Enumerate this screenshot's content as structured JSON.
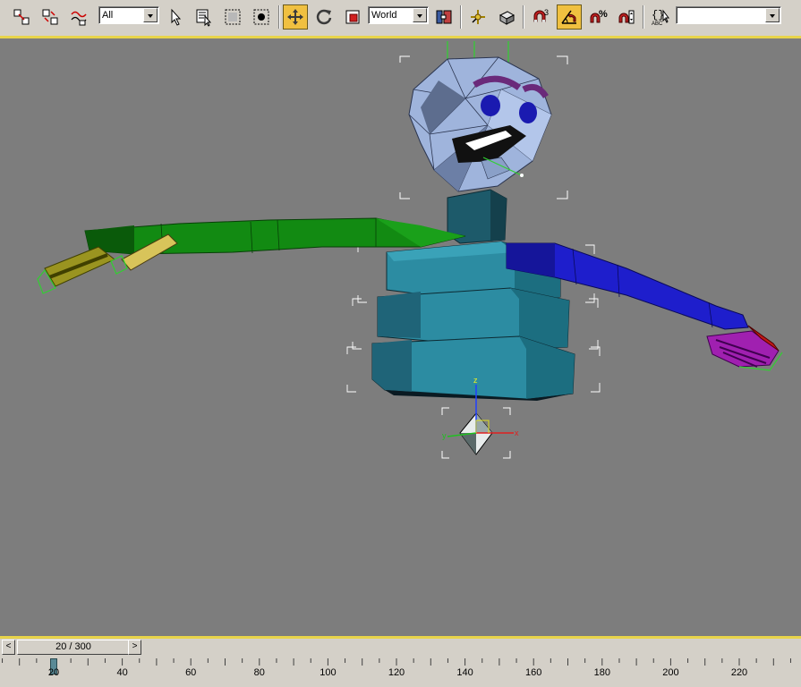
{
  "toolbar": {
    "tools": [
      {
        "name": "select-and-link-icon",
        "active": false
      },
      {
        "name": "unlink-selection-icon",
        "active": false
      },
      {
        "name": "bind-to-space-warp-icon",
        "active": false
      },
      {
        "name": "select-object-icon",
        "active": false
      },
      {
        "name": "select-by-name-icon",
        "active": false
      },
      {
        "name": "rectangular-selection-region-icon",
        "active": false
      },
      {
        "name": "window-crossing-icon",
        "active": false
      },
      {
        "name": "select-and-move-icon",
        "active": true
      },
      {
        "name": "select-and-rotate-icon",
        "active": false
      },
      {
        "name": "select-and-scale-icon",
        "active": false
      },
      {
        "name": "use-pivot-center-icon",
        "active": false
      },
      {
        "name": "select-and-manipulate-icon",
        "active": false
      },
      {
        "name": "keyboard-shortcut-override-icon",
        "active": false
      },
      {
        "name": "snaps-toggle-icon",
        "active": false
      },
      {
        "name": "angle-snap-toggle-icon",
        "active": true
      },
      {
        "name": "percent-snap-icon",
        "active": false
      },
      {
        "name": "spinner-snap-icon",
        "active": false
      },
      {
        "name": "edit-named-selection-sets-icon",
        "active": false
      }
    ],
    "selection_filter": "All",
    "reference_coord_system": "World",
    "named_selection_set": "",
    "snap_dimension_label": "3",
    "percent_label": "%",
    "abc_label": "ABC"
  },
  "viewport": {
    "background": "#7d7d7d",
    "gizmo_axes": {
      "x": "x",
      "y": "y",
      "z": "z"
    }
  },
  "timeline": {
    "prev_label": "<",
    "next_label": ">",
    "frame_display": "20 / 300",
    "current_frame": 20,
    "total_frames": 300,
    "ruler_labels": [
      "20",
      "40",
      "60",
      "80",
      "100",
      "120",
      "140",
      "160",
      "180",
      "200",
      "220"
    ]
  }
}
